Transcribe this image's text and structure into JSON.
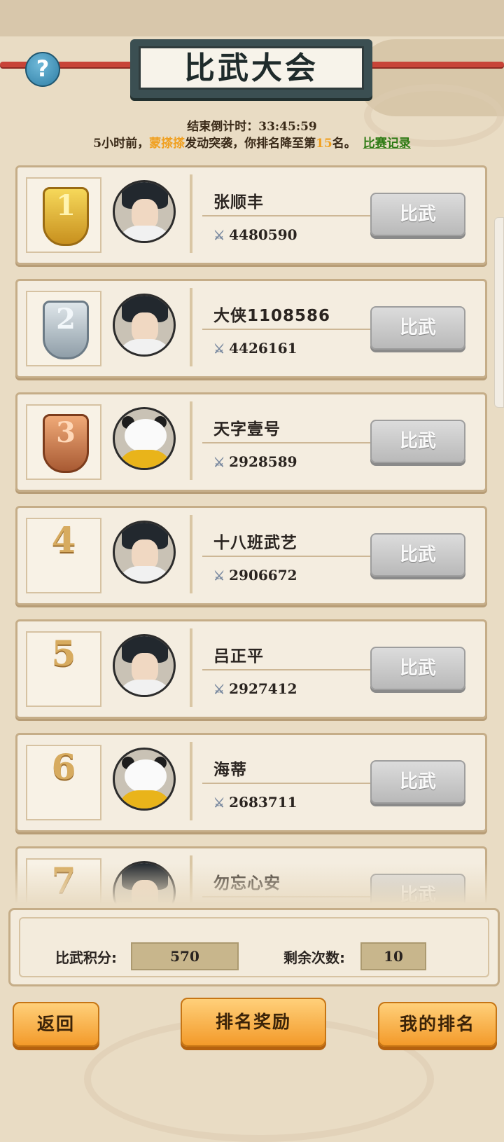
{
  "header": {
    "title": "比武大会",
    "help_icon": "question-icon"
  },
  "status": {
    "countdown": "结束倒计时：33:45:59",
    "notice_time": "5小时前，",
    "attacker": "蒙搽搽",
    "notice_mid": "发动突袭，你排名降至第",
    "rank": "15",
    "notice_end": "名。",
    "record_link": "比赛记录"
  },
  "players": [
    {
      "rank": "1",
      "name": "张顺丰",
      "power": "4480590",
      "avatar": "swordsman"
    },
    {
      "rank": "2",
      "name": "大侠1108586",
      "power": "4426161",
      "avatar": "swordsman"
    },
    {
      "rank": "3",
      "name": "天字壹号",
      "power": "2928589",
      "avatar": "panda"
    },
    {
      "rank": "4",
      "name": "十八班武艺",
      "power": "2906672",
      "avatar": "woman"
    },
    {
      "rank": "5",
      "name": "吕正平",
      "power": "2927412",
      "avatar": "warrior"
    },
    {
      "rank": "6",
      "name": "海蒂",
      "power": "2683711",
      "avatar": "panda"
    },
    {
      "rank": "7",
      "name": "勿忘心安",
      "power": "",
      "avatar": "scholar"
    }
  ],
  "fight_label": "比武",
  "score": {
    "points_label": "比武积分:",
    "points_value": "570",
    "remaining_label": "剩余次数:",
    "remaining_value": "10"
  },
  "buttons": {
    "back": "返回",
    "rank_rewards": "排名奖励",
    "my_rank": "我的排名"
  },
  "colors": {
    "accent_orange": "#f39a2a",
    "highlight": "#f0a020",
    "link_green": "#2d7a13"
  }
}
